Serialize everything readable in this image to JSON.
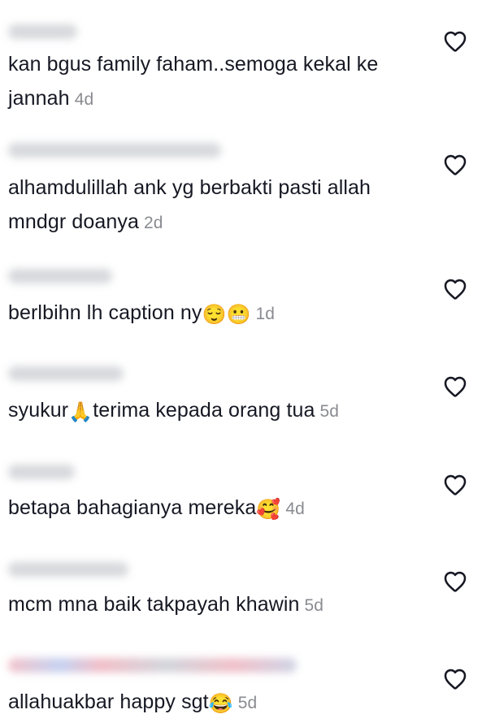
{
  "comments": [
    {
      "text": "kan bgus family faham..semoga kekal ke jannah",
      "time": "4d",
      "emoji": ""
    },
    {
      "text": "alhamdulillah ank yg berbakti pasti allah mndgr doanya",
      "time": "2d",
      "emoji": ""
    },
    {
      "text": "berlbihn lh caption ny",
      "time": "1d",
      "emoji": "😌😬"
    },
    {
      "text_before": "syukur",
      "emoji": "🙏",
      "text": "terima kepada orang tua",
      "time": "5d"
    },
    {
      "text": "betapa bahagianya mereka",
      "time": "4d",
      "emoji": "🥰"
    },
    {
      "text": "mcm mna baik takpayah khawin",
      "time": "5d",
      "emoji": ""
    },
    {
      "text": "allahuakbar happy sgt",
      "time": "5d",
      "emoji": "😂"
    }
  ],
  "icons": {
    "like": "heart-outline-icon"
  },
  "colors": {
    "text": "#161823",
    "timestamp": "#8a8b91",
    "icon": "#161823"
  }
}
